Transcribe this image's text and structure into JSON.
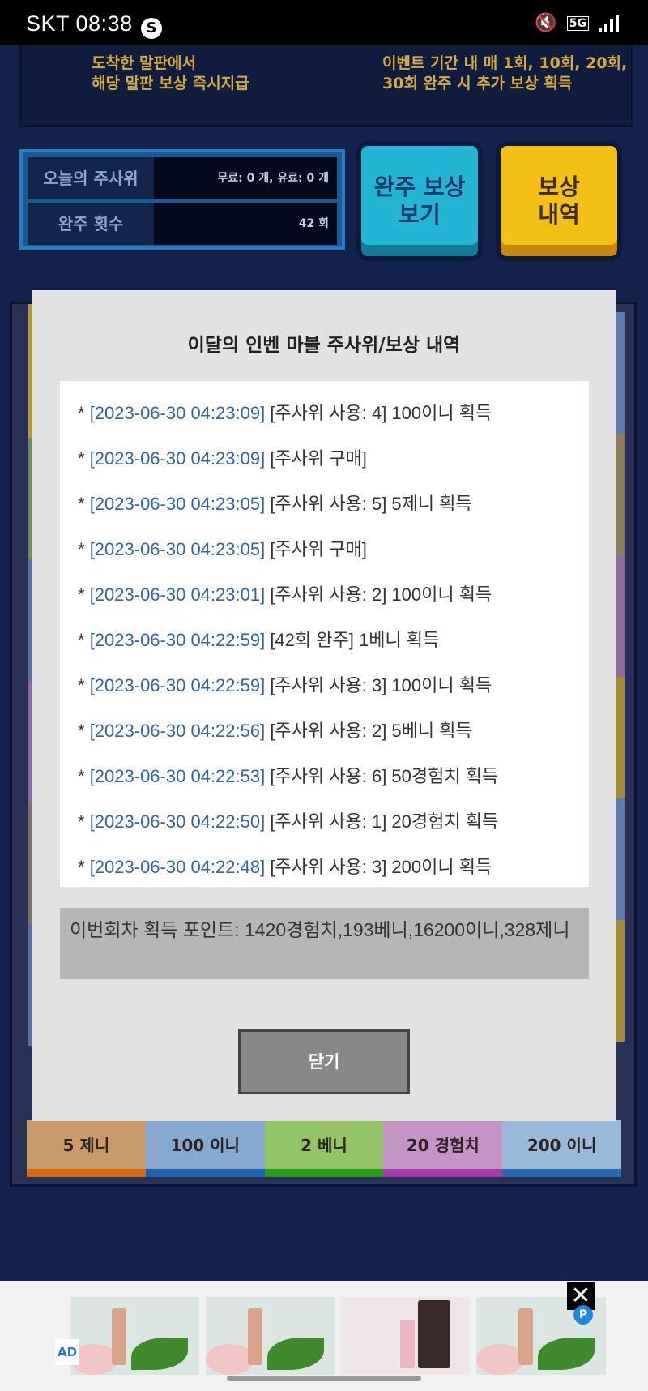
{
  "status_bar": {
    "carrier_time": "SKT 08:38",
    "shazam_glyph": "S",
    "mute_icon": "🔇",
    "network": "5G"
  },
  "top_panel": {
    "left_line1": "도착한 말판에서",
    "left_line2": "해당 말판 보상 즉시지급",
    "right_line1": "이벤트 기간 내 매 1회, 10회, 20회,",
    "right_line2": "30회 완주 시 추가 보상 획득"
  },
  "stats": {
    "dice_label": "오늘의 주사위",
    "dice_value": "무료: 0 개, 유료: 0 개",
    "laps_label": "완주 횟수",
    "laps_value": "42 회"
  },
  "buttons": {
    "completion_reward_line1": "완주 보상",
    "completion_reward_line2": "보기",
    "reward_history_line1": "보상",
    "reward_history_line2": "내역"
  },
  "tiles": [
    "5 제니",
    "100 이니",
    "2 베니",
    "20 경험치",
    "200 이니"
  ],
  "modal": {
    "title": "이달의 인벤 마블 주사위/보상 내역",
    "entries": [
      {
        "bullet": "* ",
        "time": "[2023-06-30 04:23:09]",
        "text": " [주사위 사용: 4] 100이니 획득"
      },
      {
        "bullet": "* ",
        "time": "[2023-06-30 04:23:09]",
        "text": " [주사위 구매]"
      },
      {
        "bullet": "* ",
        "time": "[2023-06-30 04:23:05]",
        "text": " [주사위 사용: 5] 5제니 획득"
      },
      {
        "bullet": "* ",
        "time": "[2023-06-30 04:23:05]",
        "text": " [주사위 구매]"
      },
      {
        "bullet": "* ",
        "time": "[2023-06-30 04:23:01]",
        "text": " [주사위 사용: 2] 100이니 획득"
      },
      {
        "bullet": "* ",
        "time": "[2023-06-30 04:22:59]",
        "text": " [42회 완주] 1베니 획득"
      },
      {
        "bullet": "* ",
        "time": "[2023-06-30 04:22:59]",
        "text": " [주사위 사용: 3] 100이니 획득"
      },
      {
        "bullet": "* ",
        "time": "[2023-06-30 04:22:56]",
        "text": " [주사위 사용: 2] 5베니 획득"
      },
      {
        "bullet": "* ",
        "time": "[2023-06-30 04:22:53]",
        "text": " [주사위 사용: 6] 50경험치 획득"
      },
      {
        "bullet": "* ",
        "time": "[2023-06-30 04:22:50]",
        "text": " [주사위 사용: 1] 20경험치 획득"
      },
      {
        "bullet": "* ",
        "time": "[2023-06-30 04:22:48]",
        "text": " [주사위 사용: 3] 200이니 획득"
      }
    ],
    "summary": "이번회차 획득 포인트: 1420경험치,193베니,16200이니,328제니",
    "close_label": "닫기"
  },
  "ad": {
    "label": "AD",
    "close_glyph": "✕",
    "info_glyph": "P"
  },
  "colors": {
    "timestamp": "#2f64a8",
    "modal_bg": "#e2e2e2",
    "page_bg": "#13224a"
  }
}
